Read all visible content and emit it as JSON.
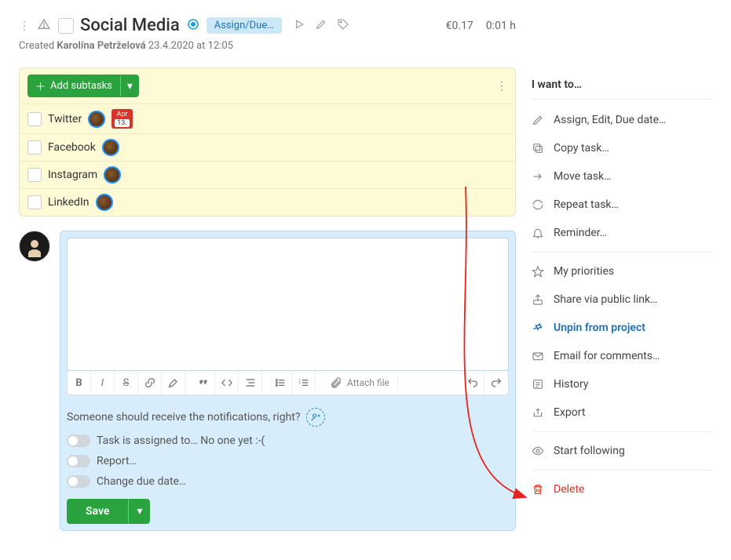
{
  "header": {
    "title": "Social Media",
    "pill": "Assign/Due…",
    "cost": "€0.17",
    "time": "0:01 h",
    "created_prefix": "Created ",
    "author": "Karolína Petrželová",
    "created_date": " 23.4.2020 at 12:05"
  },
  "subtasks": {
    "add_label": "Add subtasks",
    "items": [
      {
        "name": "Twitter",
        "badge_month": "Apr",
        "badge_day": "13."
      },
      {
        "name": "Facebook"
      },
      {
        "name": "Instagram"
      },
      {
        "name": "LinkedIn"
      }
    ]
  },
  "composer": {
    "attach_label": "Attach file",
    "notif_text": "Someone should receive the notifications, right?",
    "toggles": {
      "assign_prefix": "Task is assigned to… ",
      "assign_value": "No one yet :-(",
      "report": "Report…",
      "due": "Change due date…"
    },
    "save_label": "Save"
  },
  "sidebar": {
    "title": "I want to…",
    "items": {
      "assign": "Assign, Edit, Due date…",
      "copy": "Copy task…",
      "move": "Move task…",
      "repeat": "Repeat task…",
      "reminder": "Reminder…",
      "priorities": "My priorities",
      "share": "Share via public link…",
      "unpin": "Unpin from project",
      "email": "Email for comments…",
      "history": "History",
      "export": "Export",
      "follow": "Start following",
      "delete": "Delete"
    }
  }
}
